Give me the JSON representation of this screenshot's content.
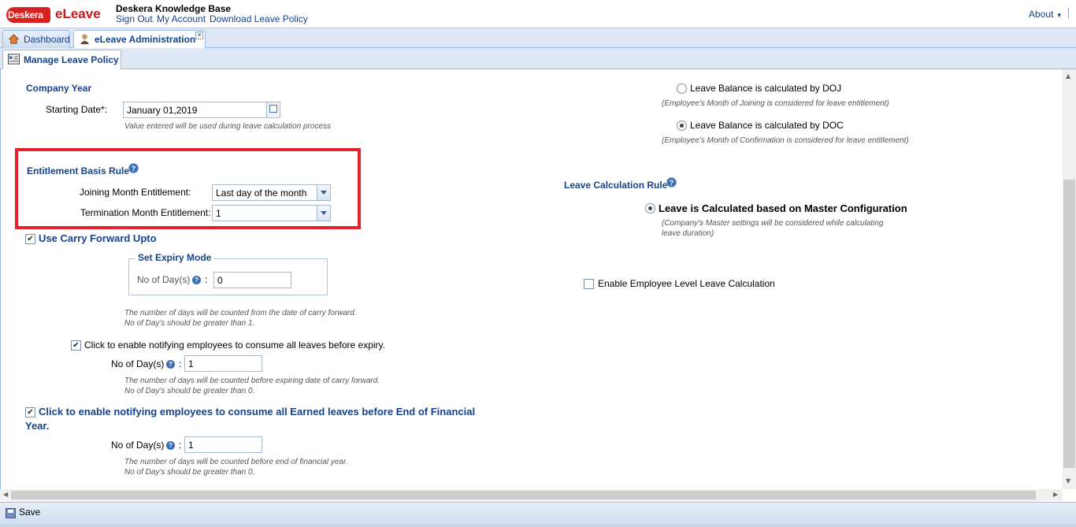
{
  "header": {
    "logo_text": "Deskera",
    "app_name": "eLeave",
    "kb_title": "Deskera Knowledge Base",
    "links": [
      "Sign Out",
      "My Account",
      "Download Leave Policy"
    ],
    "about": "About",
    "brand_color": "#c8191b"
  },
  "tabs": [
    {
      "label": "Dashboard",
      "icon": "home-icon"
    },
    {
      "label": "eLeave Administration",
      "icon": "admin-user-icon"
    }
  ],
  "subtab": {
    "label": "Manage Leave Policy",
    "icon": "policy-icon"
  },
  "company_year": {
    "title": "Company Year",
    "starting_date_label": "Starting Date*:",
    "starting_date_value": "January 01,2019",
    "hint": "Value entered will be used during leave calculation process"
  },
  "entitlement": {
    "title": "Entitlement Basis Rule",
    "joining_label": "Joining Month Entitlement:",
    "joining_value": "Last day of the month",
    "termination_label": "Termination Month Entitlement:",
    "termination_value": "1"
  },
  "carry_forward": {
    "label": "Use Carry Forward Upto",
    "checked": true,
    "expiry_legend": "Set Expiry Mode",
    "days_label": "No of Day(s)",
    "days_value": "0",
    "hint1": "The number of days will be counted from the date of carry forward.",
    "hint2": "No of Day's should be greater than 1."
  },
  "notify_expiry": {
    "label": "Click to enable notifying employees to consume all leaves before expiry.",
    "checked": true,
    "days_label": "No of Day(s)",
    "days_value": "1",
    "hint1": "The number of days will be counted before expiring date of carry forward.",
    "hint2": "No of Day's should be greater than 0."
  },
  "notify_earned": {
    "label_line1": "Click to enable notifying employees to consume all Earned leaves before End of Financial",
    "label_line2": "Year.",
    "checked": true,
    "days_label": "No of Day(s)",
    "days_value": "1",
    "hint1": "The number of days will be counted before end of financial year.",
    "hint2": "No of Day's should be greater than 0."
  },
  "leave_balance": {
    "doj_label": "Leave Balance is calculated by DOJ",
    "doj_hint": "(Employee's Month of Joining is considered for leave entitlement)",
    "doc_label": "Leave Balance is calculated by DOC",
    "doc_hint": "(Employee's Month of Confirmation is considered for leave entitlement)",
    "selected": "DOC"
  },
  "calc_rule": {
    "title": "Leave Calculation Rule",
    "option_label": "Leave is Calculated based on Master Configuration",
    "option_hint1": "(Company's Master settings will be considered while calculating",
    "option_hint2": "leave duration)",
    "employee_level_label": "Enable Employee Level Leave Calculation",
    "employee_level_checked": false
  },
  "toolbar": {
    "save_label": "Save"
  },
  "colors": {
    "section_title": "#15428b",
    "highlight_border": "#e3222d"
  }
}
